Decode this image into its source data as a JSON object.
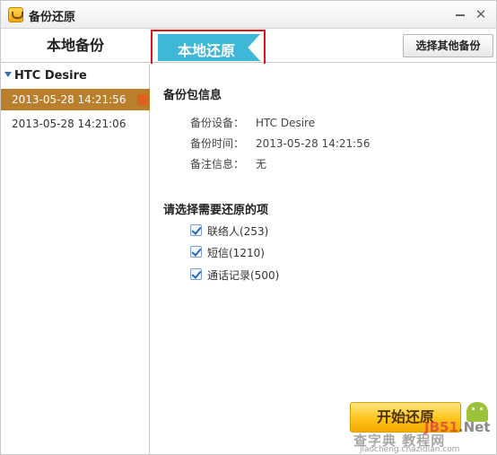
{
  "window": {
    "title": "备份还原"
  },
  "tabs": {
    "local_backup": "本地备份",
    "local_restore": "本地还原",
    "choose_other_backup": "选择其他备份"
  },
  "sidebar": {
    "device_name": "HTC Desire",
    "backups": [
      {
        "label": "2013-05-28  14:21:56",
        "selected": true
      },
      {
        "label": "2013-05-28  14:21:06",
        "selected": false
      }
    ]
  },
  "backup_info": {
    "heading": "备份包信息",
    "rows": [
      {
        "label": "备份设备：",
        "value": "HTC Desire"
      },
      {
        "label": "备份时间：",
        "value": "2013-05-28 14:21:56"
      },
      {
        "label": "备注信息：",
        "value": "无"
      }
    ]
  },
  "restore_items": {
    "heading": "请选择需要还原的项",
    "items": [
      {
        "label": "联络人(253)",
        "checked": true
      },
      {
        "label": "短信(1210)",
        "checked": true
      },
      {
        "label": "通话记录(500)",
        "checked": true
      }
    ]
  },
  "actions": {
    "start_restore": "开始还原"
  },
  "watermark": {
    "brand_red": "JB51",
    "brand_dot": ".Net",
    "cn_text": "查字典 教程网",
    "url": "jiaocheng.chazidian.com"
  },
  "colors": {
    "tab_active": "#3eb7d8",
    "selected_item": "#b97f2c",
    "highlight_frame": "#e0151c",
    "start_button": "#ffc41c"
  }
}
